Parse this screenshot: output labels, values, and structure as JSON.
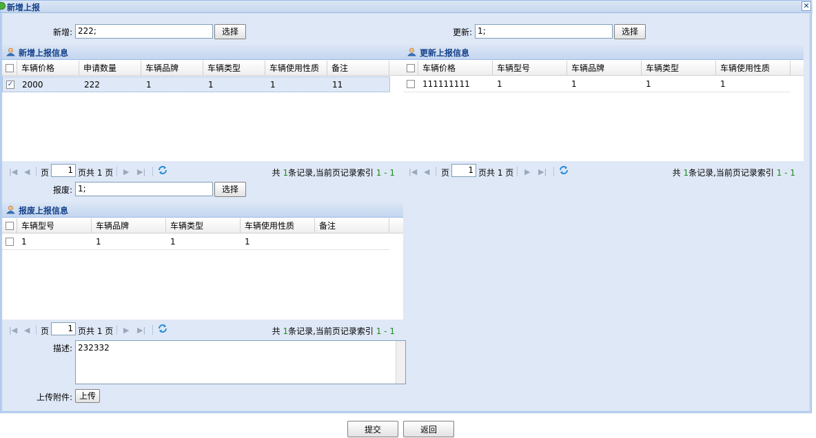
{
  "window": {
    "title": "新增上报",
    "close_glyph": "✕"
  },
  "form": {
    "add_label": "新增:",
    "add_value": "222;",
    "add_select": "选择",
    "update_label": "更新:",
    "update_value": "1;",
    "update_select": "选择",
    "scrap_label": "报废:",
    "scrap_value": "1;",
    "scrap_select": "选择",
    "desc_label": "描述:",
    "desc_value": "232332",
    "upload_label": "上传附件:",
    "upload_button": "上传"
  },
  "panel_add": {
    "title": "新增上报信息",
    "columns": [
      "车辆价格",
      "申请数量",
      "车辆品牌",
      "车辆类型",
      "车辆使用性质",
      "备注"
    ],
    "rows": [
      {
        "checked": true,
        "cells": [
          "2000",
          "222",
          "1",
          "1",
          "1",
          "11"
        ]
      }
    ]
  },
  "panel_update": {
    "title": "更新上报信息",
    "columns": [
      "车辆价格",
      "车辆型号",
      "车辆品牌",
      "车辆类型",
      "车辆使用性质"
    ],
    "rows": [
      {
        "checked": false,
        "cells": [
          "111111111",
          "1",
          "1",
          "1",
          "1"
        ]
      }
    ]
  },
  "panel_scrap": {
    "title": "报废上报信息",
    "columns": [
      "车辆型号",
      "车辆品牌",
      "车辆类型",
      "车辆使用性质",
      "备注"
    ],
    "rows": [
      {
        "checked": false,
        "cells": [
          "1",
          "1",
          "1",
          "1",
          ""
        ]
      }
    ]
  },
  "pager": {
    "page_prefix": "页",
    "page_value": "1",
    "page_suffix": "页共 1 页",
    "info_prefix": "共",
    "count": "1",
    "info_mid": "条记录,当前页记录索引",
    "range": "1 - 1"
  },
  "footer": {
    "submit": "提交",
    "back": "返回"
  },
  "colors": {
    "accent": "#15428b",
    "panel_bg": "#dfe8f6",
    "border": "#99bbe8",
    "count_green": "#1b8a1b"
  },
  "icons": {
    "title": "circle-icon",
    "panel": "user-icon",
    "refresh": "refresh-icon",
    "first": "first-page-icon",
    "prev": "prev-page-icon",
    "next": "next-page-icon",
    "last": "last-page-icon"
  }
}
